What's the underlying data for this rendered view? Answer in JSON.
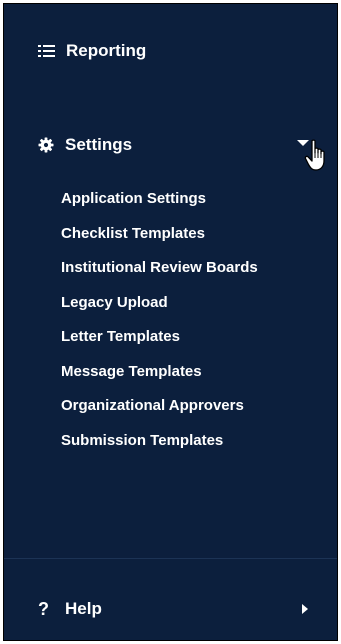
{
  "nav": {
    "reporting": {
      "label": "Reporting",
      "icon": "list-icon"
    },
    "settings": {
      "label": "Settings",
      "icon": "gear-icon",
      "expanded": true,
      "items": [
        "Application Settings",
        "Checklist Templates",
        "Institutional Review Boards",
        "Legacy Upload",
        "Letter Templates",
        "Message Templates",
        "Organizational Approvers",
        "Submission Templates"
      ]
    },
    "help": {
      "label": "Help",
      "icon": "question-icon",
      "glyph": "?"
    }
  },
  "colors": {
    "background": "#0c1f3d",
    "text": "#ffffff",
    "divider": "#1c3355"
  }
}
